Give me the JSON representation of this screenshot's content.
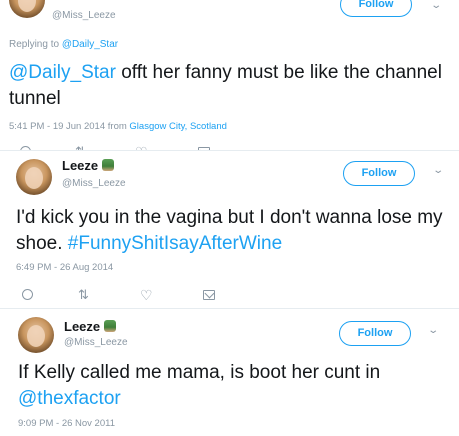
{
  "tweets": [
    {
      "user": {
        "name": "Leeze",
        "handle": "@Miss_Leeze"
      },
      "follow_label": "Follow",
      "replying_prefix": "Replying to",
      "replying_to": "@Daily_Star",
      "text_mention": "@Daily_Star",
      "text_body": " offt her fanny must be like the channel tunnel",
      "time": "5:41 PM - 19 Jun 2014",
      "from_prefix": " from ",
      "location": "Glasgow City, Scotland"
    },
    {
      "user": {
        "name": "Leeze",
        "handle": "@Miss_Leeze"
      },
      "follow_label": "Follow",
      "text_body": "I'd kick you in the vagina but I don't wanna lose my shoe. ",
      "hashtag": "#FunnyShitIsayAfterWine",
      "time": "6:49 PM - 26 Aug 2014"
    },
    {
      "user": {
        "name": "Leeze",
        "handle": "@Miss_Leeze"
      },
      "follow_label": "Follow",
      "text_body": "If Kelly called me mama, is boot her cunt in ",
      "mention": "@thexfactor",
      "time": "9:09 PM - 26 Nov 2011"
    }
  ],
  "icons": {
    "avatar": "profile-photo",
    "badge": "plant-emoji-icon",
    "reply": "reply-icon",
    "retweet": "retweet-icon",
    "like": "heart-icon",
    "dm": "envelope-icon",
    "menu": "chevron-down-icon"
  },
  "colors": {
    "link": "#1da1f2",
    "muted": "#8a97a3",
    "text": "#14171a"
  }
}
